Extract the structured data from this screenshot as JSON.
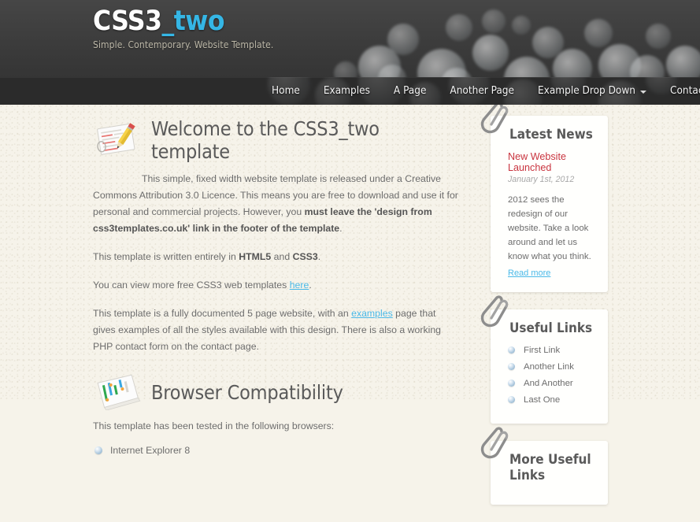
{
  "header": {
    "logo_main": "CSS3",
    "logo_accent": "_two",
    "tagline": "Simple. Contemporary. Website Template."
  },
  "nav": {
    "items": [
      {
        "label": "Home",
        "has_caret": false
      },
      {
        "label": "Examples",
        "has_caret": false
      },
      {
        "label": "A Page",
        "has_caret": false
      },
      {
        "label": "Another Page",
        "has_caret": false
      },
      {
        "label": "Example Drop Down",
        "has_caret": true
      },
      {
        "label": "Contact Us",
        "has_caret": false
      }
    ]
  },
  "main": {
    "welcome": {
      "icon": "notepad-pencil-icon",
      "title": "Welcome to the CSS3_two template",
      "para1_a": "This simple, fixed width website template is released under a Creative Commons Attribution 3.0 Licence. This means you are free to download and use it for personal and commercial projects. However, you ",
      "para1_bold": "must leave the 'design from css3templates.co.uk' link in the footer of the template",
      "para1_end": ".",
      "para2_a": "This template is written entirely in ",
      "para2_b1": "HTML5",
      "para2_mid": " and ",
      "para2_b2": "CSS3",
      "para2_end": ".",
      "para3_a": "You can view more free CSS3 web templates ",
      "para3_link": "here",
      "para3_end": ".",
      "para4_a": "This template is a fully documented 5 page website, with an ",
      "para4_link": "examples",
      "para4_end": " page that gives examples of all the styles available with this design. There is also a working PHP contact form on the contact page."
    },
    "browser": {
      "icon": "chart-document-icon",
      "title": "Browser Compatibility",
      "intro": "This template has been tested in the following browsers:",
      "list": [
        "Internet Explorer 8"
      ]
    }
  },
  "sidebar": {
    "widgets": [
      {
        "icon": "paperclip-icon",
        "title": "Latest News",
        "news_title": "New Website Launched",
        "news_date": "January 1st, 2012",
        "news_body": "2012 sees the redesign of our website. Take a look around and let us know what you think.",
        "read_more": "Read more"
      },
      {
        "icon": "paperclip-icon",
        "title": "Useful Links",
        "links": [
          "First Link",
          "Another Link",
          "And Another",
          "Last One"
        ]
      },
      {
        "icon": "paperclip-icon",
        "title": "More Useful Links"
      }
    ]
  },
  "colors": {
    "accent_blue": "#35b6e5",
    "link_blue": "#4ab9e8",
    "news_red": "#c9343f",
    "header_dark": "#3c3c3c",
    "nav_dark": "#2b2b2b",
    "paper": "#f6f3ea"
  }
}
